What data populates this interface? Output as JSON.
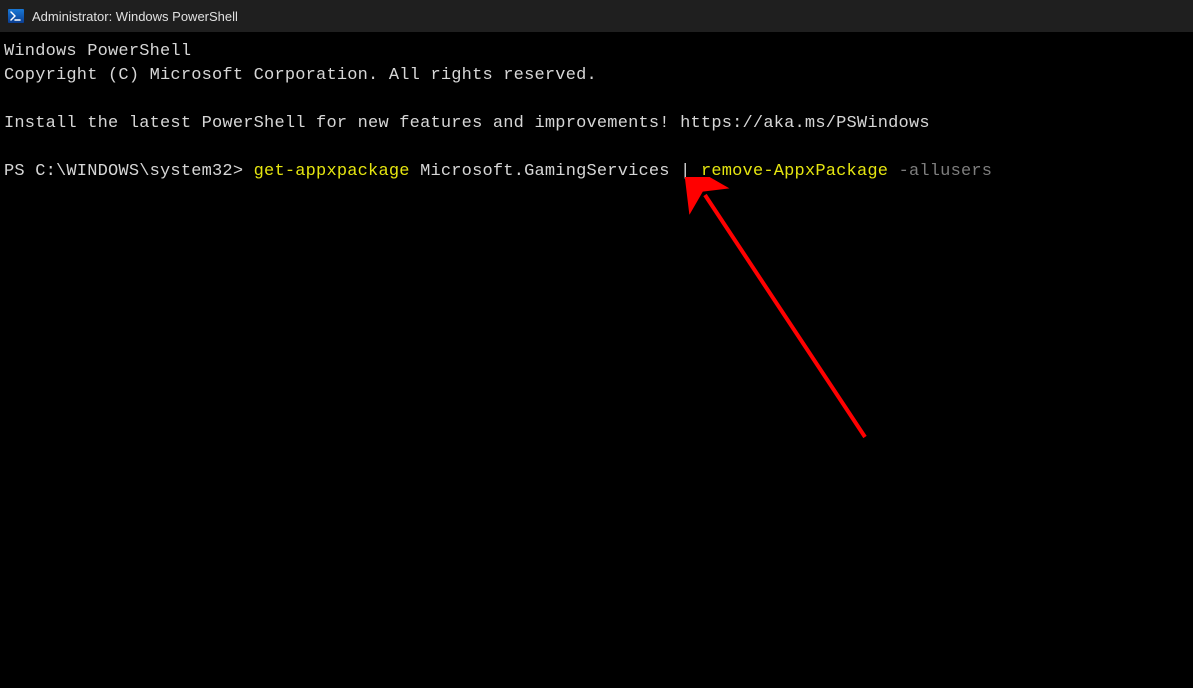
{
  "titlebar": {
    "title": "Administrator: Windows PowerShell"
  },
  "terminal": {
    "line1": "Windows PowerShell",
    "line2": "Copyright (C) Microsoft Corporation. All rights reserved.",
    "line3": "Install the latest PowerShell for new features and improvements! https://aka.ms/PSWindows",
    "prompt": "PS C:\\WINDOWS\\system32> ",
    "cmd": {
      "part1": "get-appxpackage",
      "part2": " Microsoft.GamingServices ",
      "part3": "|",
      "part4": " ",
      "part5": "remove-AppxPackage",
      "part6": " ",
      "part7": "-allusers"
    }
  }
}
